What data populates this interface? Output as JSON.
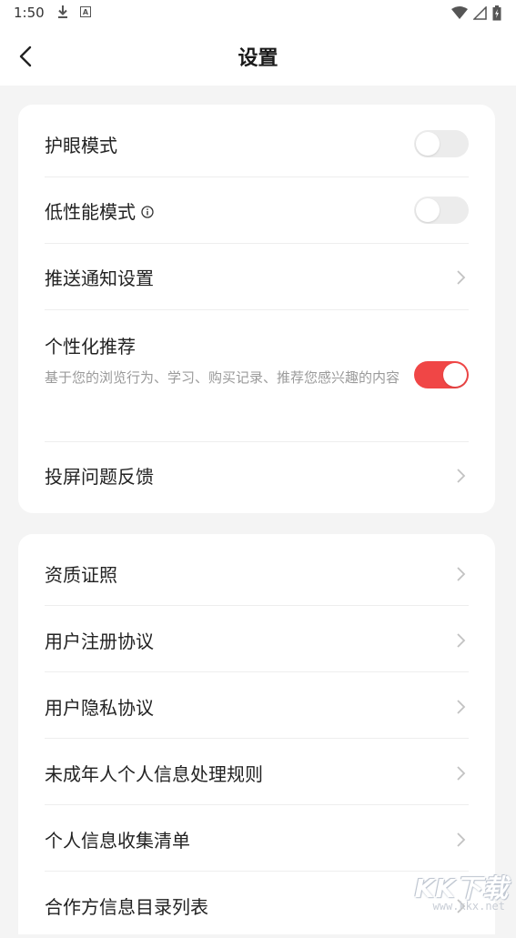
{
  "status_bar": {
    "time": "1:50",
    "icons": [
      "download-icon",
      "a-badge-icon",
      "wifi-icon",
      "signal-icon",
      "battery-icon"
    ],
    "badge_letter": "A"
  },
  "header": {
    "title": "设置",
    "back_icon": "chevron-left-icon"
  },
  "section1": {
    "eye_mode": {
      "label": "护眼模式",
      "enabled": false
    },
    "low_perf": {
      "label": "低性能模式",
      "enabled": false
    },
    "push": {
      "label": "推送通知设置"
    },
    "personal": {
      "label": "个性化推荐",
      "desc": "基于您的浏览行为、学习、购买记录、推荐您感兴趣的内容",
      "enabled": true
    },
    "cast": {
      "label": "投屏问题反馈"
    }
  },
  "section2": {
    "items": [
      {
        "label": "资质证照"
      },
      {
        "label": "用户注册协议"
      },
      {
        "label": "用户隐私协议"
      },
      {
        "label": "未成年人个人信息处理规则"
      },
      {
        "label": "个人信息收集清单"
      },
      {
        "label": "合作方信息目录列表"
      }
    ]
  },
  "watermark": {
    "logo": "KK下载",
    "url": "www.kkx.net"
  },
  "colors": {
    "accent": "#f04646",
    "background": "#f4f4f4",
    "card": "#ffffff",
    "toggle_off": "#ececec"
  }
}
